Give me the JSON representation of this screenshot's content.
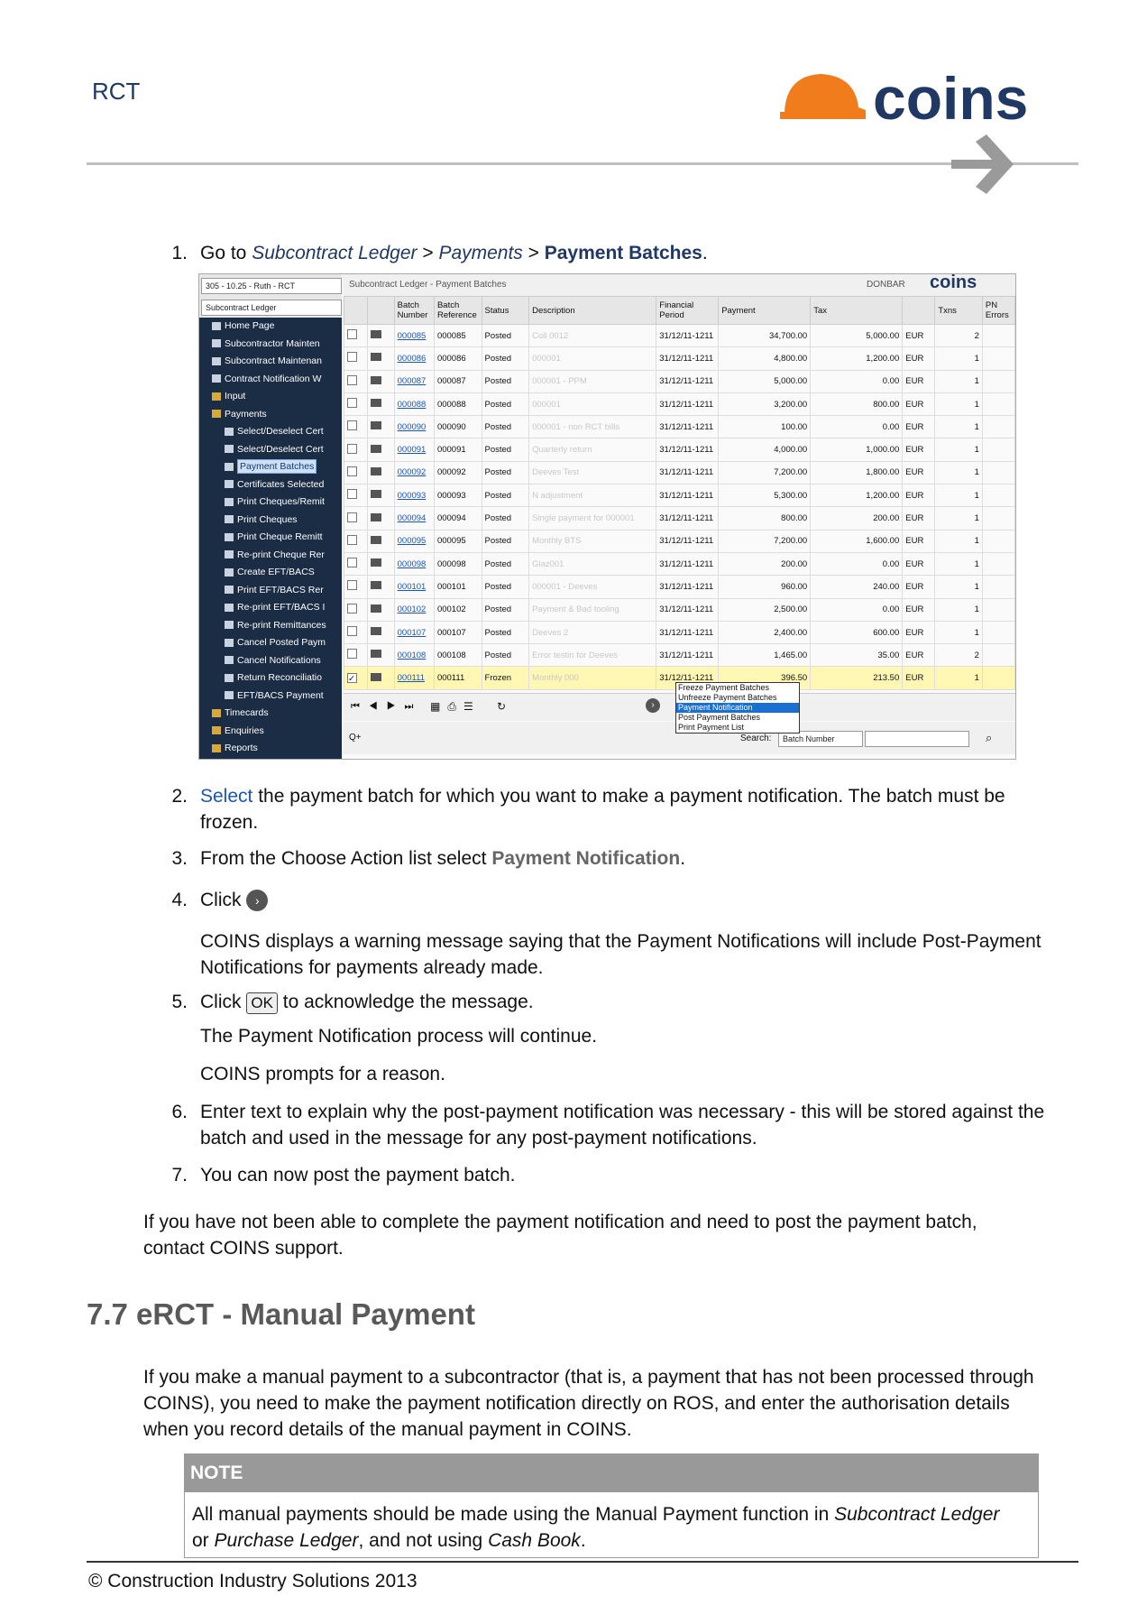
{
  "header": {
    "title": "RCT",
    "logo_text": "coins"
  },
  "steps": {
    "s1": {
      "num": "1.",
      "pre": "Go to ",
      "path1": "Subcontract Ledger",
      "sep1": " > ",
      "path2": "Payments",
      "sep2": " > ",
      "target": "Payment Batches",
      "post": "."
    },
    "s2": {
      "num": "2.",
      "link": "Select",
      "line1": " the payment batch for which you want to make a payment notification.  The batch must be",
      "line2": "frozen."
    },
    "s3": {
      "num": "3.",
      "pre": "From the Choose Action list select ",
      "action": "Payment Notification",
      "post": "."
    },
    "s4": {
      "num": "4.",
      "text": "Click",
      "para_line1": "COINS displays a warning message saying that the Payment Notifications will include Post-Payment",
      "para_line2": "Notifications for payments already made."
    },
    "s5": {
      "num": "5.",
      "pre": "Click ",
      "ok": "OK",
      "post": " to acknowledge the message.",
      "p1": "The Payment Notification process will continue.",
      "p2": "COINS prompts for a reason."
    },
    "s6": {
      "num": "6.",
      "line1": "Enter text to explain why the post-payment notification was necessary - this will be stored against the",
      "line2": "batch and used in the message for any post-payment notifications."
    },
    "s7": {
      "num": "7.",
      "text": "You can now post the payment batch."
    }
  },
  "after_steps": {
    "line1": "If you have not been able to complete the payment notification and need to post the payment batch,",
    "line2": "contact COINS support."
  },
  "section": {
    "heading": "7.7 eRCT - Manual Payment",
    "line1": "If you make a manual payment to a subcontractor (that is, a payment that has not been processed through",
    "line2": "COINS), you need to make the payment notification directly on ROS, and enter the authorisation details",
    "line3": "when you record details of the manual payment in COINS."
  },
  "note": {
    "label": "NOTE",
    "pre": "All manual payments should be made using the Manual Payment function in ",
    "i1": "Subcontract Ledger",
    "mid_line1": "",
    "line2_pre": "or ",
    "i2": "Purchase Ledger",
    "mid2": ", and not using ",
    "i3": "Cash Book",
    "end": "."
  },
  "footer": {
    "text": "© Construction Industry Solutions 2013"
  },
  "screenshot": {
    "company_select": "305 - 10.25 - Ruth - RCT",
    "module_select": "Subcontract Ledger",
    "breadcrumb": "Subcontract Ledger - Payment Batches",
    "company_code": "DONBAR",
    "logo": "coins",
    "sidebar": [
      {
        "label": "Home Page",
        "icon": "home-icon",
        "indent": 0,
        "hl": false
      },
      {
        "label": "Subcontractor Mainten",
        "icon": "tools-icon",
        "indent": 0,
        "hl": false
      },
      {
        "label": "Subcontract Maintenan",
        "icon": "tools-icon",
        "indent": 0,
        "hl": false
      },
      {
        "label": "Contract Notification W",
        "icon": "window-icon",
        "indent": 0,
        "hl": false
      },
      {
        "label": "Input",
        "icon": "folder-icon",
        "indent": 0,
        "hl": false
      },
      {
        "label": "Payments",
        "icon": "folder-icon",
        "indent": 0,
        "hl": false
      },
      {
        "label": "Select/Deselect Cert",
        "icon": "grid-icon",
        "indent": 1,
        "hl": false
      },
      {
        "label": "Select/Deselect Cert",
        "icon": "grid-icon",
        "indent": 1,
        "hl": false
      },
      {
        "label": "Payment Batches",
        "icon": "grid-icon",
        "indent": 1,
        "hl": true
      },
      {
        "label": "Certificates Selected",
        "icon": "document-icon",
        "indent": 1,
        "hl": false
      },
      {
        "label": "Print Cheques/Remit",
        "icon": "document-icon",
        "indent": 1,
        "hl": false
      },
      {
        "label": "Print Cheques",
        "icon": "document-icon",
        "indent": 1,
        "hl": false
      },
      {
        "label": "Print Cheque Remitt",
        "icon": "document-icon",
        "indent": 1,
        "hl": false
      },
      {
        "label": "Re-print Cheque Rer",
        "icon": "document-icon",
        "indent": 1,
        "hl": false
      },
      {
        "label": "Create EFT/BACS",
        "icon": "document-icon",
        "indent": 1,
        "hl": false
      },
      {
        "label": "Print EFT/BACS Rer",
        "icon": "document-icon",
        "indent": 1,
        "hl": false
      },
      {
        "label": "Re-print EFT/BACS I",
        "icon": "document-icon",
        "indent": 1,
        "hl": false
      },
      {
        "label": "Re-print Remittances",
        "icon": "document-icon",
        "indent": 1,
        "hl": false
      },
      {
        "label": "Cancel Posted Paym",
        "icon": "grid-icon",
        "indent": 1,
        "hl": false
      },
      {
        "label": "Cancel Notifications",
        "icon": "grid-icon",
        "indent": 1,
        "hl": false
      },
      {
        "label": "Return Reconciliatio",
        "icon": "window-icon",
        "indent": 1,
        "hl": false
      },
      {
        "label": "EFT/BACS Payment",
        "icon": "document-icon",
        "indent": 1,
        "hl": false
      },
      {
        "label": "Timecards",
        "icon": "folder-icon",
        "indent": 0,
        "hl": false
      },
      {
        "label": "Enquiries",
        "icon": "folder-icon",
        "indent": 0,
        "hl": false
      },
      {
        "label": "Reports",
        "icon": "folder-icon",
        "indent": 0,
        "hl": false
      }
    ],
    "columns": [
      "",
      "",
      "Batch Number",
      "Batch Reference",
      "Status",
      "Description",
      "Financial Period",
      "Payment",
      "Tax",
      "",
      "Txns",
      "PN Errors"
    ],
    "rows": [
      {
        "bn": "000085",
        "br": "000085",
        "st": "Posted",
        "desc": "Coll 0012",
        "fp": "31/12/11-1211",
        "pay": "34,700.00",
        "tax": "5,000.00",
        "cur": "EUR",
        "tx": "2",
        "sel": false
      },
      {
        "bn": "000086",
        "br": "000086",
        "st": "Posted",
        "desc": "000001",
        "fp": "31/12/11-1211",
        "pay": "4,800.00",
        "tax": "1,200.00",
        "cur": "EUR",
        "tx": "1",
        "sel": false
      },
      {
        "bn": "000087",
        "br": "000087",
        "st": "Posted",
        "desc": "000001 - PPM",
        "fp": "31/12/11-1211",
        "pay": "5,000.00",
        "tax": "0.00",
        "cur": "EUR",
        "tx": "1",
        "sel": false
      },
      {
        "bn": "000088",
        "br": "000088",
        "st": "Posted",
        "desc": "000001",
        "fp": "31/12/11-1211",
        "pay": "3,200.00",
        "tax": "800.00",
        "cur": "EUR",
        "tx": "1",
        "sel": false
      },
      {
        "bn": "000090",
        "br": "000090",
        "st": "Posted",
        "desc": "000001 - non RCT bills",
        "fp": "31/12/11-1211",
        "pay": "100.00",
        "tax": "0.00",
        "cur": "EUR",
        "tx": "1",
        "sel": false
      },
      {
        "bn": "000091",
        "br": "000091",
        "st": "Posted",
        "desc": "Quarterly return",
        "fp": "31/12/11-1211",
        "pay": "4,000.00",
        "tax": "1,000.00",
        "cur": "EUR",
        "tx": "1",
        "sel": false
      },
      {
        "bn": "000092",
        "br": "000092",
        "st": "Posted",
        "desc": "Deeves Test",
        "fp": "31/12/11-1211",
        "pay": "7,200.00",
        "tax": "1,800.00",
        "cur": "EUR",
        "tx": "1",
        "sel": false
      },
      {
        "bn": "000093",
        "br": "000093",
        "st": "Posted",
        "desc": "N adjustment",
        "fp": "31/12/11-1211",
        "pay": "5,300.00",
        "tax": "1,200.00",
        "cur": "EUR",
        "tx": "1",
        "sel": false
      },
      {
        "bn": "000094",
        "br": "000094",
        "st": "Posted",
        "desc": "Single payment for 000001",
        "fp": "31/12/11-1211",
        "pay": "800.00",
        "tax": "200.00",
        "cur": "EUR",
        "tx": "1",
        "sel": false
      },
      {
        "bn": "000095",
        "br": "000095",
        "st": "Posted",
        "desc": "Monthly BTS",
        "fp": "31/12/11-1211",
        "pay": "7,200.00",
        "tax": "1,600.00",
        "cur": "EUR",
        "tx": "1",
        "sel": false
      },
      {
        "bn": "000098",
        "br": "000098",
        "st": "Posted",
        "desc": "Glaz001",
        "fp": "31/12/11-1211",
        "pay": "200.00",
        "tax": "0.00",
        "cur": "EUR",
        "tx": "1",
        "sel": false
      },
      {
        "bn": "000101",
        "br": "000101",
        "st": "Posted",
        "desc": "000001 - Deeves",
        "fp": "31/12/11-1211",
        "pay": "960.00",
        "tax": "240.00",
        "cur": "EUR",
        "tx": "1",
        "sel": false
      },
      {
        "bn": "000102",
        "br": "000102",
        "st": "Posted",
        "desc": "Payment & Bad tooling",
        "fp": "31/12/11-1211",
        "pay": "2,500.00",
        "tax": "0.00",
        "cur": "EUR",
        "tx": "1",
        "sel": false
      },
      {
        "bn": "000107",
        "br": "000107",
        "st": "Posted",
        "desc": "Deeves 2",
        "fp": "31/12/11-1211",
        "pay": "2,400.00",
        "tax": "600.00",
        "cur": "EUR",
        "tx": "1",
        "sel": false
      },
      {
        "bn": "000108",
        "br": "000108",
        "st": "Posted",
        "desc": "Error testin for Deeves",
        "fp": "31/12/11-1211",
        "pay": "1,465.00",
        "tax": "35.00",
        "cur": "EUR",
        "tx": "2",
        "sel": false
      },
      {
        "bn": "000111",
        "br": "000111",
        "st": "Frozen",
        "desc": "Monthly 000",
        "fp": "31/12/11-1211",
        "pay": "396.50",
        "tax": "213.50",
        "cur": "EUR",
        "tx": "1",
        "sel": true
      }
    ],
    "action_menu": [
      "Freeze Payment Batches",
      "Unfreeze Payment Batches",
      "Payment Notification",
      "Post Payment Batches",
      "Print Payment List"
    ],
    "action_selected_index": 2,
    "search_label": "Search:",
    "search_field": "Batch Number"
  }
}
